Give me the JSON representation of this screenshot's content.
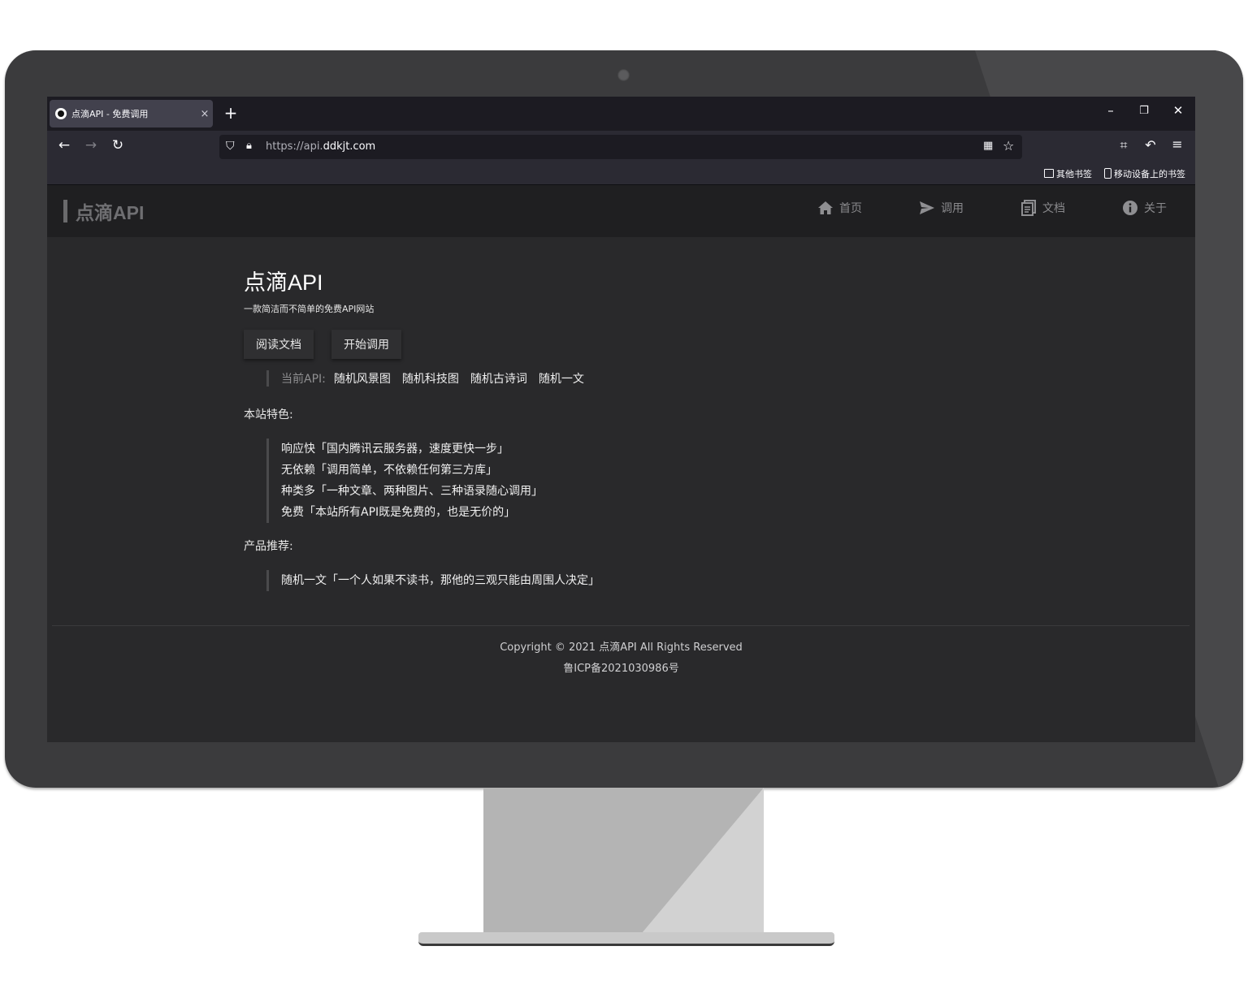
{
  "browser": {
    "tab_title": "点滴API - 免费调用",
    "tab_close": "×",
    "new_tab": "+",
    "url_prefix": "https://api.",
    "url_domain": "ddkjt.com",
    "bookmarks": [
      "其他书签",
      "移动设备上的书签"
    ]
  },
  "site": {
    "brand": "点滴API",
    "menu": [
      {
        "label": "首页",
        "icon": "home-icon"
      },
      {
        "label": "调用",
        "icon": "send-icon"
      },
      {
        "label": "文档",
        "icon": "docs-icon"
      },
      {
        "label": "关于",
        "icon": "info-icon"
      }
    ],
    "hero": {
      "title": "点滴API",
      "subtitle": "一款简洁而不简单的免费API网站"
    },
    "buttons": {
      "read_docs": "阅读文档",
      "start_call": "开始调用"
    },
    "current_api": {
      "label": "当前API:",
      "links": [
        "随机风景图",
        "随机科技图",
        "随机古诗词",
        "随机一文"
      ]
    },
    "features_title": "本站特色:",
    "features": [
      "响应快「国内腾讯云服务器，速度更快一步」",
      "无依赖「调用简单，不依赖任何第三方库」",
      "种类多「一种文章、两种图片、三种语录随心调用」",
      "免费「本站所有API既是免费的，也是无价的」"
    ],
    "products_title": "产品推荐:",
    "products": [
      "随机一文「一个人如果不读书，那他的三观只能由周围人决定」"
    ],
    "footer": {
      "copyright": "Copyright © 2021 点滴API All Rights Reserved",
      "icp": "鲁ICP备2021030986号"
    }
  }
}
